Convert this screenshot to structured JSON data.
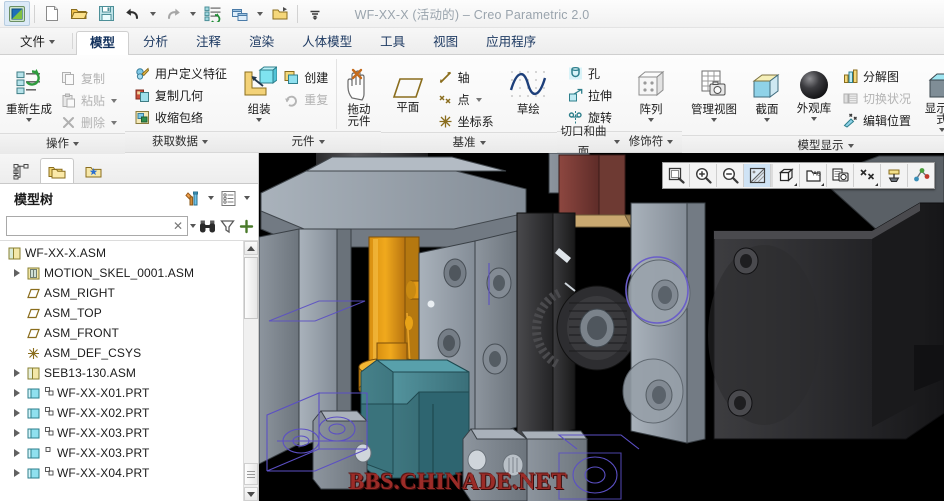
{
  "window": {
    "title": "WF-XX-X (活动的) – Creo Parametric 2.0"
  },
  "quick_access": {
    "items": [
      {
        "name": "creo-logo-icon",
        "label": "Creo"
      },
      {
        "name": "new-file-icon",
        "label": "新建"
      },
      {
        "name": "open-file-icon",
        "label": "打开"
      },
      {
        "name": "save-icon",
        "label": "保存"
      },
      {
        "name": "undo-icon",
        "label": "撤消"
      },
      {
        "name": "undo-dropdown-caret",
        "label": ""
      },
      {
        "name": "redo-icon",
        "label": "重做"
      },
      {
        "name": "redo-dropdown-caret",
        "label": ""
      },
      {
        "name": "regenerate-icon",
        "label": "重新生成"
      },
      {
        "name": "window-icon",
        "label": "窗口"
      },
      {
        "name": "window-dropdown-caret",
        "label": ""
      },
      {
        "name": "close-window-icon",
        "label": "关闭"
      },
      {
        "name": "customize-qat-caret",
        "label": "自定义快速访问工具栏"
      }
    ]
  },
  "ribbon": {
    "tabs": [
      {
        "label": "文件",
        "name": "tab-file",
        "selected": false,
        "dropdown": true
      },
      {
        "label": "模型",
        "name": "tab-model",
        "selected": true
      },
      {
        "label": "分析",
        "name": "tab-analysis",
        "selected": false
      },
      {
        "label": "注释",
        "name": "tab-annotate",
        "selected": false
      },
      {
        "label": "渲染",
        "name": "tab-render",
        "selected": false
      },
      {
        "label": "人体模型",
        "name": "tab-manikin",
        "selected": false
      },
      {
        "label": "工具",
        "name": "tab-tools",
        "selected": false
      },
      {
        "label": "视图",
        "name": "tab-view",
        "selected": false
      },
      {
        "label": "应用程序",
        "name": "tab-applications",
        "selected": false
      }
    ],
    "groups": [
      {
        "name": "group-operations",
        "label": "操作",
        "big": [
          {
            "label": "重新生成",
            "name": "regenerate-button",
            "icon": "regenerate-icon",
            "dropdown": true,
            "disabled": false
          }
        ],
        "small": [
          {
            "label": "复制",
            "name": "copy-button",
            "icon": "copy-icon",
            "disabled": true,
            "dropdown": false
          },
          {
            "label": "粘贴",
            "name": "paste-button",
            "icon": "paste-icon",
            "disabled": true,
            "dropdown": true
          },
          {
            "label": "删除",
            "name": "delete-button",
            "icon": "delete-icon",
            "disabled": true,
            "dropdown": true
          }
        ]
      },
      {
        "name": "group-get-data",
        "label": "获取数据",
        "big": [],
        "small": [
          {
            "label": "用户定义特征",
            "name": "udf-button",
            "icon": "udf-icon",
            "disabled": false,
            "dropdown": false
          },
          {
            "label": "复制几何",
            "name": "copy-geometry-button",
            "icon": "copy-geometry-icon",
            "disabled": false,
            "dropdown": false
          },
          {
            "label": "收缩包络",
            "name": "shrinkwrap-button",
            "icon": "shrinkwrap-icon",
            "disabled": false,
            "dropdown": false
          }
        ]
      },
      {
        "name": "group-component",
        "label": "元件",
        "big": [
          {
            "label": "组装",
            "name": "assemble-button",
            "icon": "assemble-icon",
            "dropdown": true,
            "disabled": false
          },
          {
            "label": "拖动元件",
            "name": "drag-component-button",
            "icon": "drag-component-icon",
            "dropdown": false,
            "disabled": false
          }
        ],
        "small": [
          {
            "label": "创建",
            "name": "create-button",
            "icon": "create-icon",
            "disabled": false,
            "dropdown": false
          },
          {
            "label": "重复",
            "name": "repeat-button",
            "icon": "repeat-icon",
            "disabled": true,
            "dropdown": false
          }
        ]
      },
      {
        "name": "group-datum",
        "label": "基准",
        "big": [
          {
            "label": "平面",
            "name": "datum-plane-button",
            "icon": "datum-plane-icon",
            "dropdown": false,
            "disabled": false
          },
          {
            "label": "草绘",
            "name": "sketch-button",
            "icon": "sketch-icon",
            "dropdown": false,
            "disabled": false
          }
        ],
        "small": [
          {
            "label": "轴",
            "name": "datum-axis-button",
            "icon": "datum-axis-icon",
            "disabled": false,
            "dropdown": false
          },
          {
            "label": "点",
            "name": "datum-point-button",
            "icon": "datum-point-icon",
            "disabled": false,
            "dropdown": true
          },
          {
            "label": "坐标系",
            "name": "coordinate-system-button",
            "icon": "csys-icon",
            "disabled": false,
            "dropdown": false
          }
        ]
      },
      {
        "name": "group-cut-surface",
        "label": "切口和曲面",
        "big": [],
        "small": [
          {
            "label": "孔",
            "name": "hole-button",
            "icon": "hole-icon",
            "disabled": false,
            "dropdown": false
          },
          {
            "label": "拉伸",
            "name": "extrude-button",
            "icon": "extrude-icon",
            "disabled": false,
            "dropdown": false
          },
          {
            "label": "旋转",
            "name": "revolve-button",
            "icon": "revolve-icon",
            "disabled": false,
            "dropdown": false
          }
        ]
      },
      {
        "name": "group-modifiers",
        "label": "修饰符",
        "big": [
          {
            "label": "阵列",
            "name": "pattern-button",
            "icon": "pattern-icon",
            "dropdown": true,
            "disabled": false
          }
        ],
        "small": []
      },
      {
        "name": "group-model-display",
        "label": "模型显示",
        "big": [
          {
            "label": "管理视图",
            "name": "manage-views-button",
            "icon": "manage-views-icon",
            "dropdown": true,
            "disabled": false
          },
          {
            "label": "截面",
            "name": "section-button",
            "icon": "section-icon",
            "dropdown": true,
            "disabled": false
          },
          {
            "label": "外观库",
            "name": "appearance-gallery-button",
            "icon": "appearance-icon",
            "dropdown": true,
            "disabled": false
          },
          {
            "label": "显示样式",
            "name": "display-style-button",
            "icon": "display-style-icon",
            "dropdown": true,
            "disabled": false
          }
        ],
        "small": [
          {
            "label": "分解图",
            "name": "explode-view-button",
            "icon": "explode-view-icon",
            "disabled": false,
            "dropdown": false
          },
          {
            "label": "切换状况",
            "name": "toggle-status-button",
            "icon": "toggle-status-icon",
            "disabled": true,
            "dropdown": false
          },
          {
            "label": "编辑位置",
            "name": "edit-position-button",
            "icon": "edit-position-icon",
            "disabled": false,
            "dropdown": false
          }
        ]
      }
    ]
  },
  "navigator": {
    "tabs": [
      {
        "name": "navtab-model-tree",
        "label": "模型树",
        "icon": "model-tree-icon",
        "selected": false
      },
      {
        "name": "navtab-folder-browser",
        "label": "文件夹浏览器",
        "icon": "folder-browser-icon",
        "selected": true
      },
      {
        "name": "navtab-favorites",
        "label": "收藏夹",
        "icon": "favorites-folder-icon",
        "selected": false
      }
    ],
    "title": "模型树",
    "header_buttons": [
      {
        "name": "settings-tools-icon",
        "label": "设置",
        "caret": true
      },
      {
        "name": "display-list-icon",
        "label": "显示",
        "caret": true
      }
    ],
    "search": {
      "value": "",
      "placeholder": "",
      "clear_label": "✕",
      "buttons": [
        {
          "name": "find-binoculars-icon",
          "label": "查找"
        },
        {
          "name": "filter-funnel-icon",
          "label": "过滤"
        },
        {
          "name": "add-plus-icon",
          "label": "添加"
        }
      ]
    },
    "tree": [
      {
        "label": "WF-XX-X.ASM",
        "icon": "assembly-icon",
        "indent": 0,
        "arrow": false,
        "sub": ""
      },
      {
        "label": "MOTION_SKEL_0001.ASM",
        "icon": "skeleton-assembly-icon",
        "indent": 1,
        "arrow": true,
        "sub": ""
      },
      {
        "label": "ASM_RIGHT",
        "icon": "datum-plane-icon",
        "indent": 1,
        "arrow": false,
        "sub": ""
      },
      {
        "label": "ASM_TOP",
        "icon": "datum-plane-icon",
        "indent": 1,
        "arrow": false,
        "sub": ""
      },
      {
        "label": "ASM_FRONT",
        "icon": "datum-plane-icon",
        "indent": 1,
        "arrow": false,
        "sub": ""
      },
      {
        "label": "ASM_DEF_CSYS",
        "icon": "csys-icon",
        "indent": 1,
        "arrow": false,
        "sub": ""
      },
      {
        "label": "SEB13-130.ASM",
        "icon": "assembly-icon",
        "indent": 1,
        "arrow": true,
        "sub": ""
      },
      {
        "label": "WF-XX-X01.PRT",
        "icon": "part-icon",
        "indent": 1,
        "arrow": true,
        "sub": "footprint"
      },
      {
        "label": "WF-XX-X02.PRT",
        "icon": "part-icon",
        "indent": 1,
        "arrow": true,
        "sub": "footprint"
      },
      {
        "label": "WF-XX-X03.PRT",
        "icon": "part-icon",
        "indent": 1,
        "arrow": true,
        "sub": "footprint"
      },
      {
        "label": "WF-XX-X03.PRT",
        "icon": "part-icon",
        "indent": 1,
        "arrow": true,
        "sub": "single"
      },
      {
        "label": "WF-XX-X04.PRT",
        "icon": "part-icon",
        "indent": 1,
        "arrow": true,
        "sub": "footprint"
      }
    ]
  },
  "graphics": {
    "toolbar": [
      {
        "name": "zoom-to-fit-icon",
        "label": "重新调整",
        "selected": false,
        "corner": false
      },
      {
        "name": "zoom-in-icon",
        "label": "放大",
        "selected": false,
        "corner": false
      },
      {
        "name": "zoom-out-icon",
        "label": "缩小",
        "selected": false,
        "corner": false
      },
      {
        "name": "repaint-icon",
        "label": "重画",
        "selected": true,
        "corner": false
      },
      {
        "name": "display-style-icon",
        "label": "显示样式",
        "selected": false,
        "corner": true
      },
      {
        "name": "saved-views-icon",
        "label": "已保存视图",
        "selected": false,
        "corner": true
      },
      {
        "name": "view-manager-icon",
        "label": "视图管理器",
        "selected": false,
        "corner": false
      },
      {
        "name": "datum-display-icon",
        "label": "基准显示过滤器",
        "selected": false,
        "corner": true
      },
      {
        "name": "annotation-display-icon",
        "label": "注释显示",
        "selected": false,
        "corner": false
      },
      {
        "name": "spin-center-icon",
        "label": "旋转中心",
        "selected": false,
        "corner": false
      }
    ],
    "watermark": "BBS.CHINADE.NET",
    "background": "#000000"
  },
  "colors": {
    "accent": "#1f3b63",
    "gold": "#e8a317",
    "teal": "#3f7d85",
    "steel": "#9aa3ad",
    "dark_part": "#3a3a3c",
    "datum_line": "#4b3fb0",
    "watermark": "#9b2c28"
  }
}
